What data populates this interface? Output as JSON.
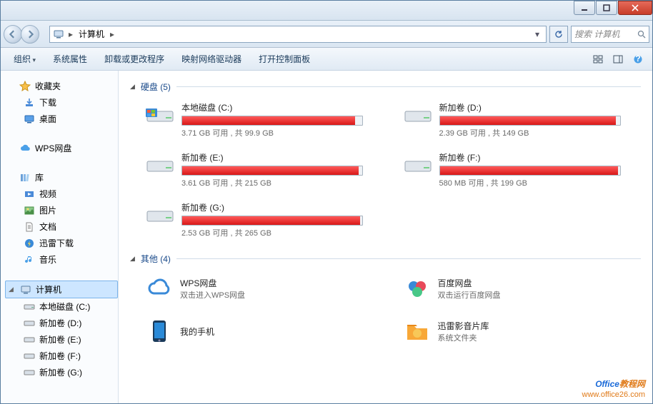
{
  "titlebar": {},
  "address": {
    "root_icon": "computer-icon",
    "crumb1": "计算机",
    "search_placeholder": "搜索 计算机"
  },
  "toolbar": {
    "organize": "组织",
    "system_props": "系统属性",
    "uninstall": "卸载或更改程序",
    "map_drive": "映射网络驱动器",
    "control_panel": "打开控制面板"
  },
  "sidebar": {
    "favorites": {
      "label": "收藏夹",
      "items": [
        {
          "label": "下载",
          "icon": "download-icon"
        },
        {
          "label": "桌面",
          "icon": "desktop-icon"
        }
      ]
    },
    "wps": {
      "label": "WPS网盘",
      "icon": "cloud-icon"
    },
    "libraries": {
      "label": "库",
      "items": [
        {
          "label": "视频",
          "icon": "video-icon"
        },
        {
          "label": "图片",
          "icon": "picture-icon"
        },
        {
          "label": "文档",
          "icon": "document-icon"
        },
        {
          "label": "迅雷下载",
          "icon": "thunder-icon"
        },
        {
          "label": "音乐",
          "icon": "music-icon"
        }
      ]
    },
    "computer": {
      "label": "计算机",
      "items": [
        {
          "label": "本地磁盘 (C:)",
          "icon": "drive-c-icon"
        },
        {
          "label": "新加卷 (D:)",
          "icon": "drive-icon"
        },
        {
          "label": "新加卷 (E:)",
          "icon": "drive-icon"
        },
        {
          "label": "新加卷 (F:)",
          "icon": "drive-icon"
        },
        {
          "label": "新加卷 (G:)",
          "icon": "drive-icon"
        }
      ]
    }
  },
  "sections": {
    "drives_header": "硬盘 (5)",
    "other_header": "其他 (4)"
  },
  "drives": [
    {
      "name": "本地磁盘 (C:)",
      "sub": "3.71 GB 可用 , 共 99.9 GB",
      "pct": 96
    },
    {
      "name": "新加卷 (D:)",
      "sub": "2.39 GB 可用 , 共 149 GB",
      "pct": 98
    },
    {
      "name": "新加卷 (E:)",
      "sub": "3.61 GB 可用 , 共 215 GB",
      "pct": 98
    },
    {
      "name": "新加卷 (F:)",
      "sub": "580 MB 可用 , 共 199 GB",
      "pct": 99
    },
    {
      "name": "新加卷 (G:)",
      "sub": "2.53 GB 可用 , 共 265 GB",
      "pct": 99
    }
  ],
  "others": [
    {
      "name": "WPS网盘",
      "sub": "双击进入WPS网盘",
      "icon": "wps-cloud-icon"
    },
    {
      "name": "百度网盘",
      "sub": "双击运行百度网盘",
      "icon": "baidu-cloud-icon"
    },
    {
      "name": "我的手机",
      "sub": "",
      "icon": "phone-icon"
    },
    {
      "name": "迅雷影音片库",
      "sub": "系统文件夹",
      "icon": "thunder-folder-icon"
    }
  ],
  "watermark": {
    "line1a": "Office",
    "line1b": "教程网",
    "line2": "www.office26.com"
  }
}
